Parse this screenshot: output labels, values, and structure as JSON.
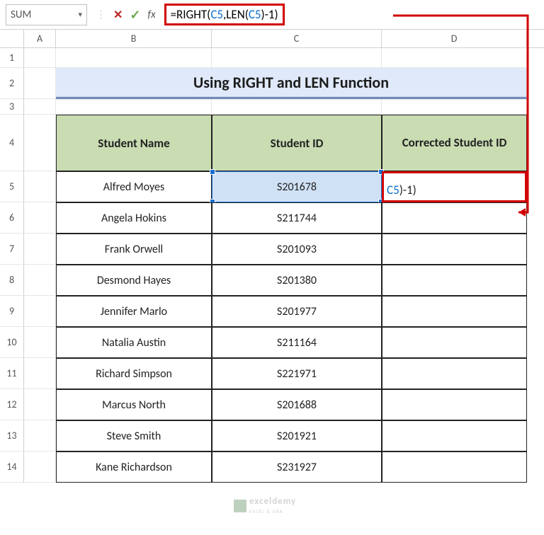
{
  "name_box": "SUM",
  "formula": {
    "raw": "=RIGHT(C5,LEN(C5)-1)",
    "parts": [
      {
        "txt": "=",
        "cls": "fpart"
      },
      {
        "txt": "RIGHT",
        "cls": "fpart"
      },
      {
        "txt": "(",
        "cls": "fpart"
      },
      {
        "txt": "C5",
        "cls": "fref"
      },
      {
        "txt": ",",
        "cls": "fpart"
      },
      {
        "txt": "LEN",
        "cls": "fpart"
      },
      {
        "txt": "(",
        "cls": "fpart"
      },
      {
        "txt": "C5",
        "cls": "fref2"
      },
      {
        "txt": ")",
        "cls": "fpart"
      },
      {
        "txt": "-1)",
        "cls": "fpart"
      }
    ]
  },
  "columns": [
    "A",
    "B",
    "C",
    "D"
  ],
  "rows": [
    "1",
    "2",
    "3",
    "4",
    "5",
    "6",
    "7",
    "8",
    "9",
    "10",
    "11",
    "12",
    "13",
    "14"
  ],
  "title": "Using RIGHT and LEN Function",
  "headers": {
    "b": "Student Name",
    "c": "Student ID",
    "d": "Corrected Student ID"
  },
  "d5_display": "C5)-1)",
  "data": [
    {
      "name": "Alfred Moyes",
      "id": "S201678"
    },
    {
      "name": "Angela Hokins",
      "id": "S211744"
    },
    {
      "name": "Frank Orwell",
      "id": "S201093"
    },
    {
      "name": "Desmond Hayes",
      "id": "S201380"
    },
    {
      "name": "Jennifer Marlo",
      "id": "S201977"
    },
    {
      "name": "Natalia Austin",
      "id": "S211164"
    },
    {
      "name": "Richard Simpson",
      "id": "S221971"
    },
    {
      "name": "Marcus North",
      "id": "S201688"
    },
    {
      "name": "Steve Smith",
      "id": "S201921"
    },
    {
      "name": "Kane Richardson",
      "id": "S231927"
    }
  ],
  "watermark": {
    "line1": "exceldemy",
    "line2": "EXCEL & VBA"
  }
}
